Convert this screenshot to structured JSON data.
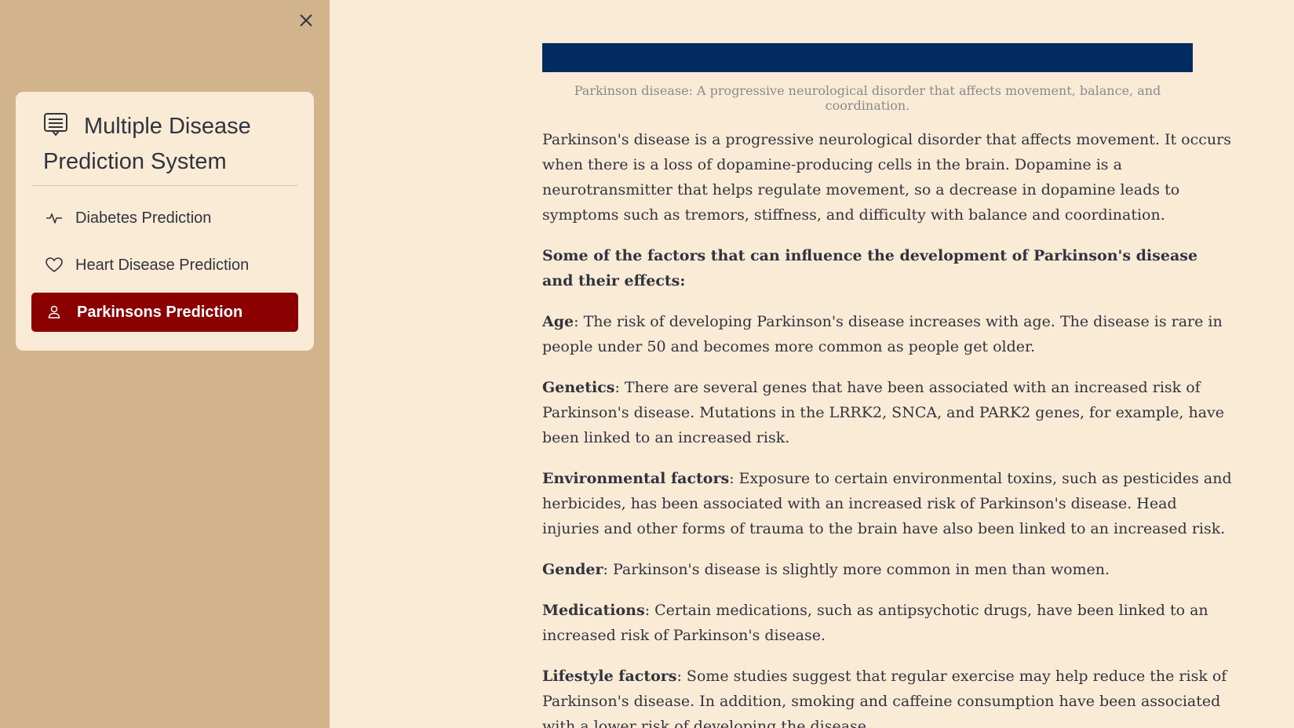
{
  "sidebar": {
    "close_icon": "close-icon",
    "menu_title": "Multiple Disease Prediction System",
    "menu_icon": "list-icon",
    "items": [
      {
        "label": "Diabetes Prediction",
        "icon": "activity-icon",
        "active": false
      },
      {
        "label": "Heart Disease Prediction",
        "icon": "heart-icon",
        "active": false
      },
      {
        "label": "Parkinsons Prediction",
        "icon": "person-icon",
        "active": true
      }
    ],
    "colors": {
      "sidebar_bg": "#d2b48c",
      "card_bg": "#faebd7",
      "active_bg": "#8b0000"
    }
  },
  "main": {
    "banner_color": "#022b5f",
    "caption": "Parkinson disease: A progressive neurological disorder that affects movement, balance, and coordination.",
    "intro": "Parkinson's disease is a progressive neurological disorder that affects movement. It occurs when there is a loss of dopamine-producing cells in the brain. Dopamine is a neurotransmitter that helps regulate movement, so a decrease in dopamine leads to symptoms such as tremors, stiffness, and difficulty with balance and coordination.",
    "factors_heading": "Some of the factors that can influence the development of Parkinson's disease and their effects:",
    "factors": [
      {
        "term": "Age",
        "text": ": The risk of developing Parkinson's disease increases with age. The disease is rare in people under 50 and becomes more common as people get older."
      },
      {
        "term": "Genetics",
        "text": ": There are several genes that have been associated with an increased risk of Parkinson's disease. Mutations in the LRRK2, SNCA, and PARK2 genes, for example, have been linked to an increased risk."
      },
      {
        "term": "Environmental factors",
        "text": ": Exposure to certain environmental toxins, such as pesticides and herbicides, has been associated with an increased risk of Parkinson's disease. Head injuries and other forms of trauma to the brain have also been linked to an increased risk."
      },
      {
        "term": "Gender",
        "text": ": Parkinson's disease is slightly more common in men than women."
      },
      {
        "term": "Medications",
        "text": ": Certain medications, such as antipsychotic drugs, have been linked to an increased risk of Parkinson's disease."
      },
      {
        "term": "Lifestyle factors",
        "text": ": Some studies suggest that regular exercise may help reduce the risk of Parkinson's disease. In addition, smoking and caffeine consumption have been associated with a lower risk of developing the disease."
      }
    ]
  },
  "background_color": "#faebd7"
}
